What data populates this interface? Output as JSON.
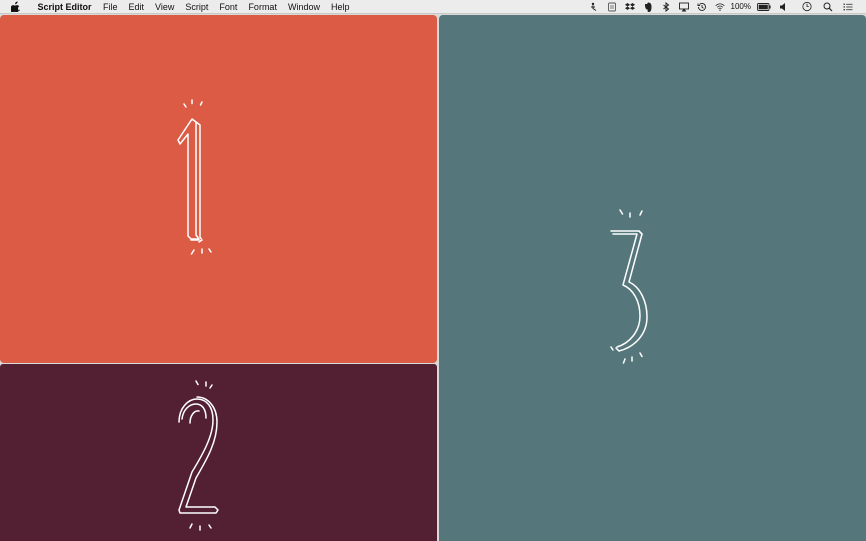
{
  "menubar": {
    "app_name": "Script Editor",
    "menu_items": [
      "File",
      "Edit",
      "View",
      "Script",
      "Font",
      "Format",
      "Window",
      "Help"
    ],
    "battery_percent": "100%",
    "icons": [
      "apple-icon",
      "dropbox-icon",
      "evernote-icon",
      "bluetooth-icon",
      "airplay-icon",
      "time-machine-icon",
      "wifi-icon",
      "battery-icon",
      "volume-icon",
      "clock-icon",
      "spotlight-search-icon",
      "notification-center-icon"
    ]
  },
  "panes": [
    {
      "name": "pane-1",
      "background": "#db5b45",
      "numeral": "1"
    },
    {
      "name": "pane-2",
      "background": "#531f33",
      "numeral": "2"
    },
    {
      "name": "pane-3",
      "background": "#55777c",
      "numeral": "3"
    }
  ]
}
